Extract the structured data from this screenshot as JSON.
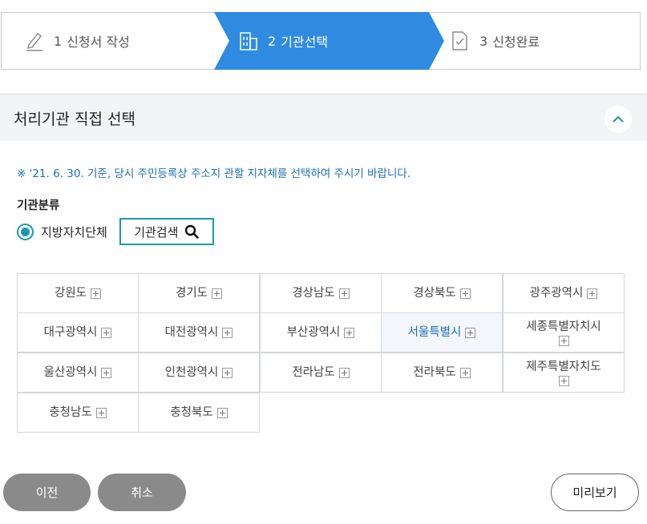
{
  "stepper": {
    "steps": [
      {
        "num": "1",
        "label": "신청서 작성"
      },
      {
        "num": "2",
        "label": "기관선택"
      },
      {
        "num": "3",
        "label": "신청완료"
      }
    ],
    "active_color": "#2e8be0"
  },
  "section": {
    "title": "처리기관 직접 선택"
  },
  "notice": "※ '21. 6. 30. 기준, 당시 주민등록상 주소지 관할 지자체를 선택하여 주시기 바랍니다.",
  "category": {
    "label": "기관분류",
    "radio_label": "지방자치단체",
    "radio_selected": true,
    "search_label": "기관검색"
  },
  "regions": [
    {
      "name": "강원도"
    },
    {
      "name": "경기도"
    },
    {
      "name": "경상남도"
    },
    {
      "name": "경상북도"
    },
    {
      "name": "광주광역시"
    },
    {
      "name": "대구광역시"
    },
    {
      "name": "대전광역시"
    },
    {
      "name": "부산광역시"
    },
    {
      "name": "서울특별시",
      "selected": true
    },
    {
      "name": "세종특별자치시"
    },
    {
      "name": "울산광역시"
    },
    {
      "name": "인천광역시"
    },
    {
      "name": "전라남도"
    },
    {
      "name": "전라북도"
    },
    {
      "name": "제주특별자치도"
    },
    {
      "name": "충청남도"
    },
    {
      "name": "충청북도"
    }
  ],
  "buttons": {
    "prev": "이전",
    "cancel": "취소",
    "preview": "미리보기"
  },
  "colors": {
    "accent": "#1a9aa8",
    "link": "#1b6fb5",
    "button_gray": "#8a8a8a"
  }
}
